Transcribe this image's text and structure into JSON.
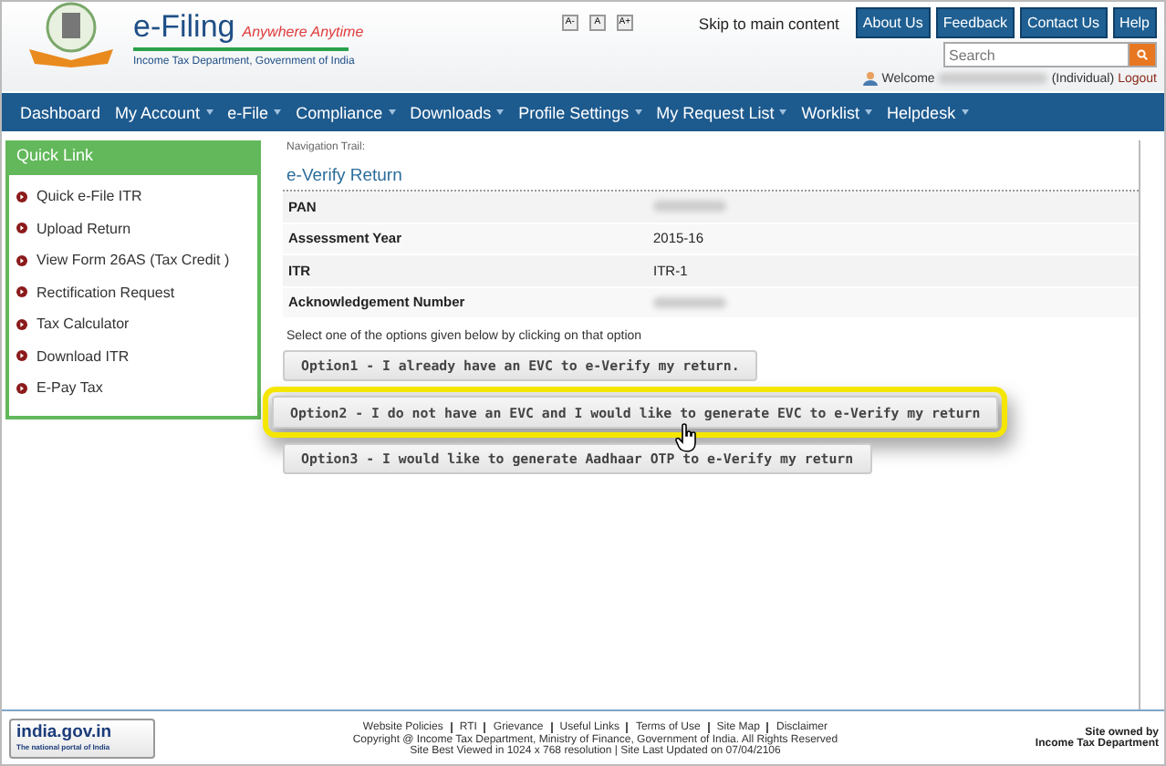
{
  "header": {
    "logo_title": "e-Filing",
    "tagline": "Anywhere Anytime",
    "department": "Income Tax Department, Government of India",
    "font_controls": [
      "A-",
      "A",
      "A+"
    ],
    "skip_link": "Skip to main content",
    "top_buttons": [
      "About Us",
      "Feedback",
      "Contact Us",
      "Help"
    ],
    "search": {
      "placeholder": "Search"
    },
    "welcome": "Welcome",
    "user_type": "(Individual)",
    "logout": "Logout"
  },
  "nav": [
    {
      "label": "Dashboard",
      "dropdown": false
    },
    {
      "label": "My Account",
      "dropdown": true
    },
    {
      "label": "e-File",
      "dropdown": true
    },
    {
      "label": "Compliance",
      "dropdown": true
    },
    {
      "label": "Downloads",
      "dropdown": true
    },
    {
      "label": "Profile Settings",
      "dropdown": true
    },
    {
      "label": "My Request List",
      "dropdown": true
    },
    {
      "label": "Worklist",
      "dropdown": true
    },
    {
      "label": "Helpdesk",
      "dropdown": true
    }
  ],
  "quick_links": {
    "title": "Quick Link",
    "items": [
      "Quick e-File ITR",
      "Upload Return",
      "View Form 26AS (Tax Credit )",
      "Rectification Request",
      "Tax Calculator",
      "Download ITR",
      "E-Pay Tax"
    ]
  },
  "navigation_trail": "Navigation Trail:",
  "page_title": "e-Verify Return",
  "details": [
    {
      "label": "PAN",
      "blurred": true
    },
    {
      "label": "Assessment Year",
      "value": "2015-16",
      "blurred": false
    },
    {
      "label": "ITR",
      "value": "ITR-1",
      "blurred": false
    },
    {
      "label": "Acknowledgement Number",
      "blurred": true
    }
  ],
  "instruction": "Select one of the options given below by clicking on that option",
  "options": [
    {
      "label": "Option1 - I already have an EVC to e-Verify my return.",
      "selected": false
    },
    {
      "label": "Option2 - I do not have an EVC and I would like to generate EVC to e-Verify my return",
      "selected": true
    },
    {
      "label": "Option3 - I would like to generate Aadhaar OTP to e-Verify my return",
      "selected": false
    }
  ],
  "footer": {
    "portal_name": "india.gov.in",
    "portal_tagline": "The national portal of India",
    "links": [
      "Website Policies",
      "RTI",
      "Grievance",
      "Useful Links",
      "Terms of Use",
      "Site Map",
      "Disclaimer"
    ],
    "copyright": "Copyright @ Income Tax Department, Ministry of Finance, Government of India. All Rights Reserved",
    "site_info": "Site Best Viewed in 1024 x 768 resolution | Site Last Updated on 07/04/2106",
    "owner_label": "Site owned by",
    "owner": "Income Tax Department"
  }
}
